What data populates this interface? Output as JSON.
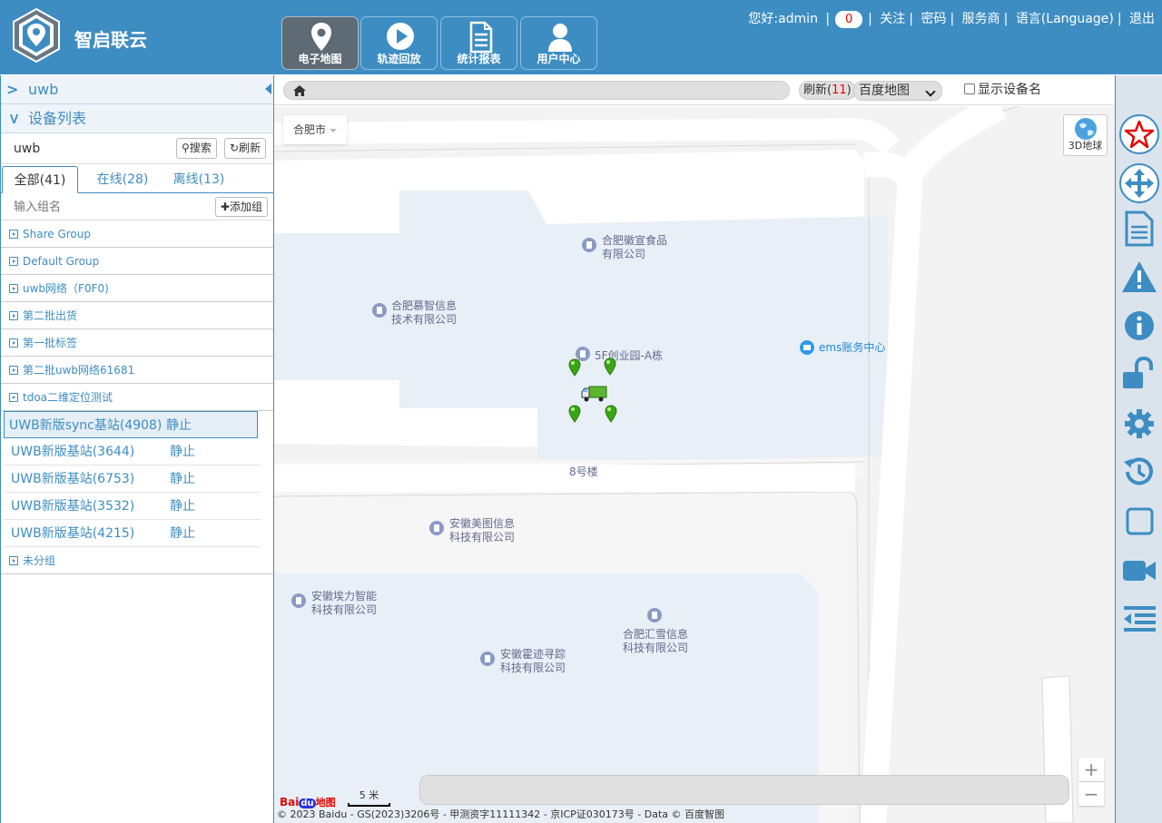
{
  "brand": "智启联云",
  "nav": [
    {
      "label": "电子地图",
      "icon": "map-pin-icon",
      "active": true
    },
    {
      "label": "轨迹回放",
      "icon": "play-icon",
      "active": false
    },
    {
      "label": "统计报表",
      "icon": "report-icon",
      "active": false
    },
    {
      "label": "用户中心",
      "icon": "user-icon",
      "active": false
    }
  ],
  "topbar": {
    "greeting": "您好:admin",
    "message_count": "0",
    "follow": "关注",
    "password": "密码",
    "provider": "服务商",
    "language": "语言(Language)",
    "logout": "退出"
  },
  "left": {
    "account_header": "uwb",
    "devices_header": "设备列表",
    "search_value": "uwb",
    "search_label": "搜索",
    "refresh_label": "刷新",
    "tabs": [
      {
        "label": "全部(41)",
        "active": true
      },
      {
        "label": "在线(28)",
        "active": false
      },
      {
        "label": "离线(13)",
        "active": false
      }
    ],
    "group_placeholder": "输入组名",
    "add_group_label": "添加组",
    "groups_before": [
      "Share Group",
      "Default Group",
      "uwb网络（F0F0)",
      "第二批出货",
      "第一批标签",
      "第二批uwb网络61681",
      "tdoa二维定位测试"
    ],
    "devices": [
      {
        "name": "UWB新版sync基站(4908)",
        "status": "静止",
        "selected": true
      },
      {
        "name": "UWB新版基站(3644)",
        "status": "静止",
        "selected": false
      },
      {
        "name": "UWB新版基站(6753)",
        "status": "静止",
        "selected": false
      },
      {
        "name": "UWB新版基站(3532)",
        "status": "静止",
        "selected": false
      },
      {
        "name": "UWB新版基站(4215)",
        "status": "静止",
        "selected": false
      }
    ],
    "ungrouped": "未分组"
  },
  "maptoolbar": {
    "refresh_label": "刷新(",
    "refresh_count": "11",
    "refresh_close": ")",
    "map_type": "百度地图",
    "show_device_name": "显示设备名"
  },
  "map": {
    "city": "合肥市",
    "globe_label": "3D地球",
    "pois": [
      {
        "line1": "合肥徽宣食品",
        "line2": "有限公司"
      },
      {
        "line1": "合肥慕智信息",
        "line2": "技术有限公司"
      },
      {
        "line1": "5F创业园-A栋",
        "line2": ""
      },
      {
        "line1": "ems账务中心",
        "line2": ""
      },
      {
        "line1": "8号楼",
        "line2": ""
      },
      {
        "line1": "安徽美图信息",
        "line2": "科技有限公司"
      },
      {
        "line1": "安徽埃力智能",
        "line2": "科技有限公司"
      },
      {
        "line1": "合肥汇雪信息",
        "line2": "科技有限公司"
      },
      {
        "line1": "安徽霍迹寻踪",
        "line2": "科技有限公司"
      }
    ],
    "scale_label": "5 米",
    "copyright": "© 2023 Baidu - GS(2023)3206号 - 甲测资字11111342 - 京ICP证030173号 - Data © 百度智图",
    "baidu_logo_a": "Bai",
    "baidu_logo_b": "地图",
    "zoom_in": "+",
    "zoom_out": "−"
  },
  "right_tools": [
    "star-icon",
    "move-icon",
    "document-icon",
    "warning-icon",
    "info-icon",
    "unlock-icon",
    "gear-icon",
    "history-icon",
    "square-icon",
    "video-icon",
    "indent-icon"
  ],
  "colors": {
    "header": "#3d8dc3",
    "accent": "#3d8dc3",
    "active_nav": "#5e6a74",
    "marker": "#3aa617"
  }
}
